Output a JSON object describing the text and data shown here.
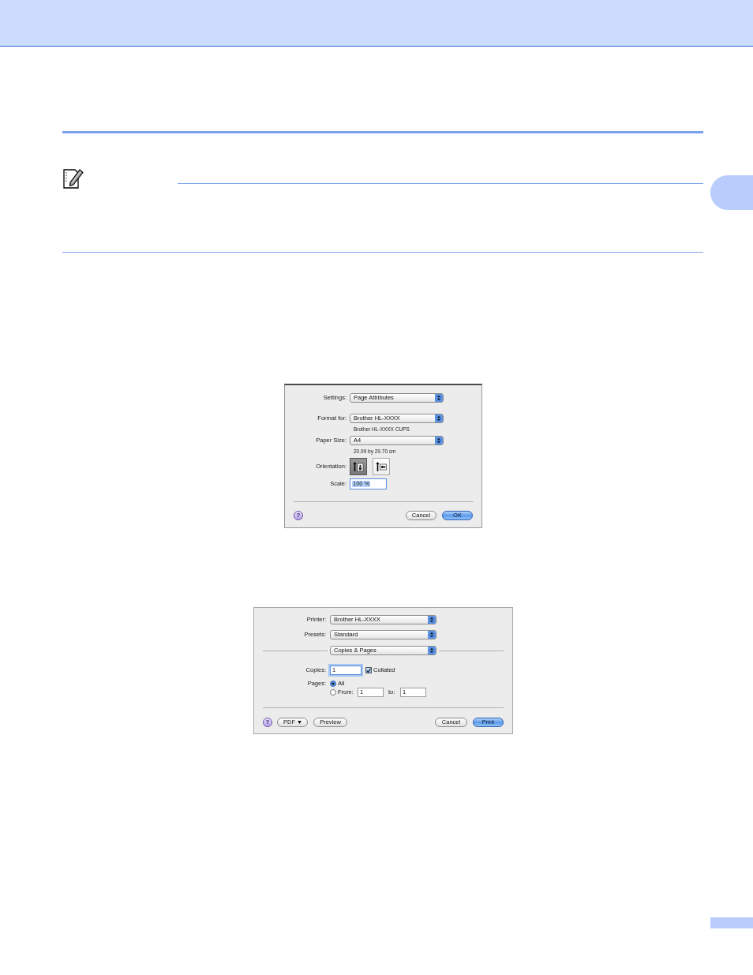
{
  "page_setup_dialog": {
    "rows": [
      {
        "kind": "popup",
        "label": "Settings:",
        "value": "Page Attributes"
      },
      {
        "kind": "popup",
        "label": "Format for:",
        "value": "Brother HL-XXXX",
        "detail": "Brother HL-XXXX CUPS"
      },
      {
        "kind": "popup",
        "label": "Paper Size:",
        "value": "A4",
        "detail": "20.99 by 29.70 cm"
      },
      {
        "kind": "orientation",
        "label": "Orientation:",
        "options": [
          {
            "kind": "portrait",
            "selected": true
          },
          {
            "kind": "landscape",
            "selected": false
          }
        ]
      },
      {
        "kind": "field",
        "label": "Scale:",
        "value": "100 %",
        "text_selected": true
      }
    ],
    "help_button": "?",
    "buttons": [
      {
        "label": "Cancel",
        "default": false
      },
      {
        "label": "OK",
        "default": true
      }
    ]
  },
  "print_dialog": {
    "popups": [
      {
        "label": "Printer:",
        "value": "Brother HL-XXXX"
      },
      {
        "label": "Presets:",
        "value": "Standard"
      }
    ],
    "panel_popup": {
      "value": "Copies & Pages"
    },
    "copies": {
      "label": "Copies:",
      "value": "1",
      "focused": true
    },
    "collated": {
      "label": "Collated",
      "checked": true
    },
    "pages": {
      "label": "Pages:",
      "options": [
        {
          "kind": "all",
          "label": "All",
          "selected": true
        },
        {
          "kind": "range",
          "label": "From:",
          "selected": false,
          "from": "1",
          "to_label": "to:",
          "to": "1"
        }
      ]
    },
    "help_button": "?",
    "left_buttons": [
      {
        "label": "PDF",
        "menu": true
      },
      {
        "label": "Preview",
        "menu": false
      }
    ],
    "right_buttons": [
      {
        "label": "Cancel",
        "default": false
      },
      {
        "label": "Print",
        "default": true
      }
    ]
  }
}
